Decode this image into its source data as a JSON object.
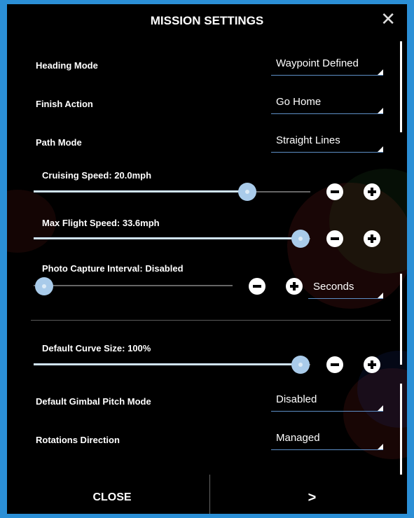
{
  "dialog": {
    "title": "MISSION SETTINGS",
    "close_icon": "✕"
  },
  "rows": {
    "heading_mode": {
      "label": "Heading Mode",
      "value": "Waypoint Defined"
    },
    "finish_action": {
      "label": "Finish Action",
      "value": "Go Home"
    },
    "path_mode": {
      "label": "Path Mode",
      "value": "Straight Lines"
    },
    "cruising_speed": {
      "label": "Cruising Speed: 20.0mph",
      "slider_fraction": 0.78
    },
    "max_flight_speed": {
      "label": "Max Flight Speed: 33.6mph",
      "slider_fraction": 1.0
    },
    "photo_capture_interval": {
      "label": "Photo Capture Interval: Disabled",
      "slider_fraction": 0.0,
      "unit": "Seconds"
    },
    "default_curve_size": {
      "label": "Default Curve Size: 100%",
      "slider_fraction": 1.0
    },
    "gimbal_pitch_mode": {
      "label": "Default Gimbal Pitch Mode",
      "value": "Disabled"
    },
    "rotations_direction": {
      "label": "Rotations Direction",
      "value": "Managed"
    }
  },
  "footer": {
    "close_label": "CLOSE",
    "next_label": ">"
  },
  "colors": {
    "accent": "#a9cbea",
    "underline": "#5d8fc6",
    "frame_border": "#2b8fd6"
  }
}
